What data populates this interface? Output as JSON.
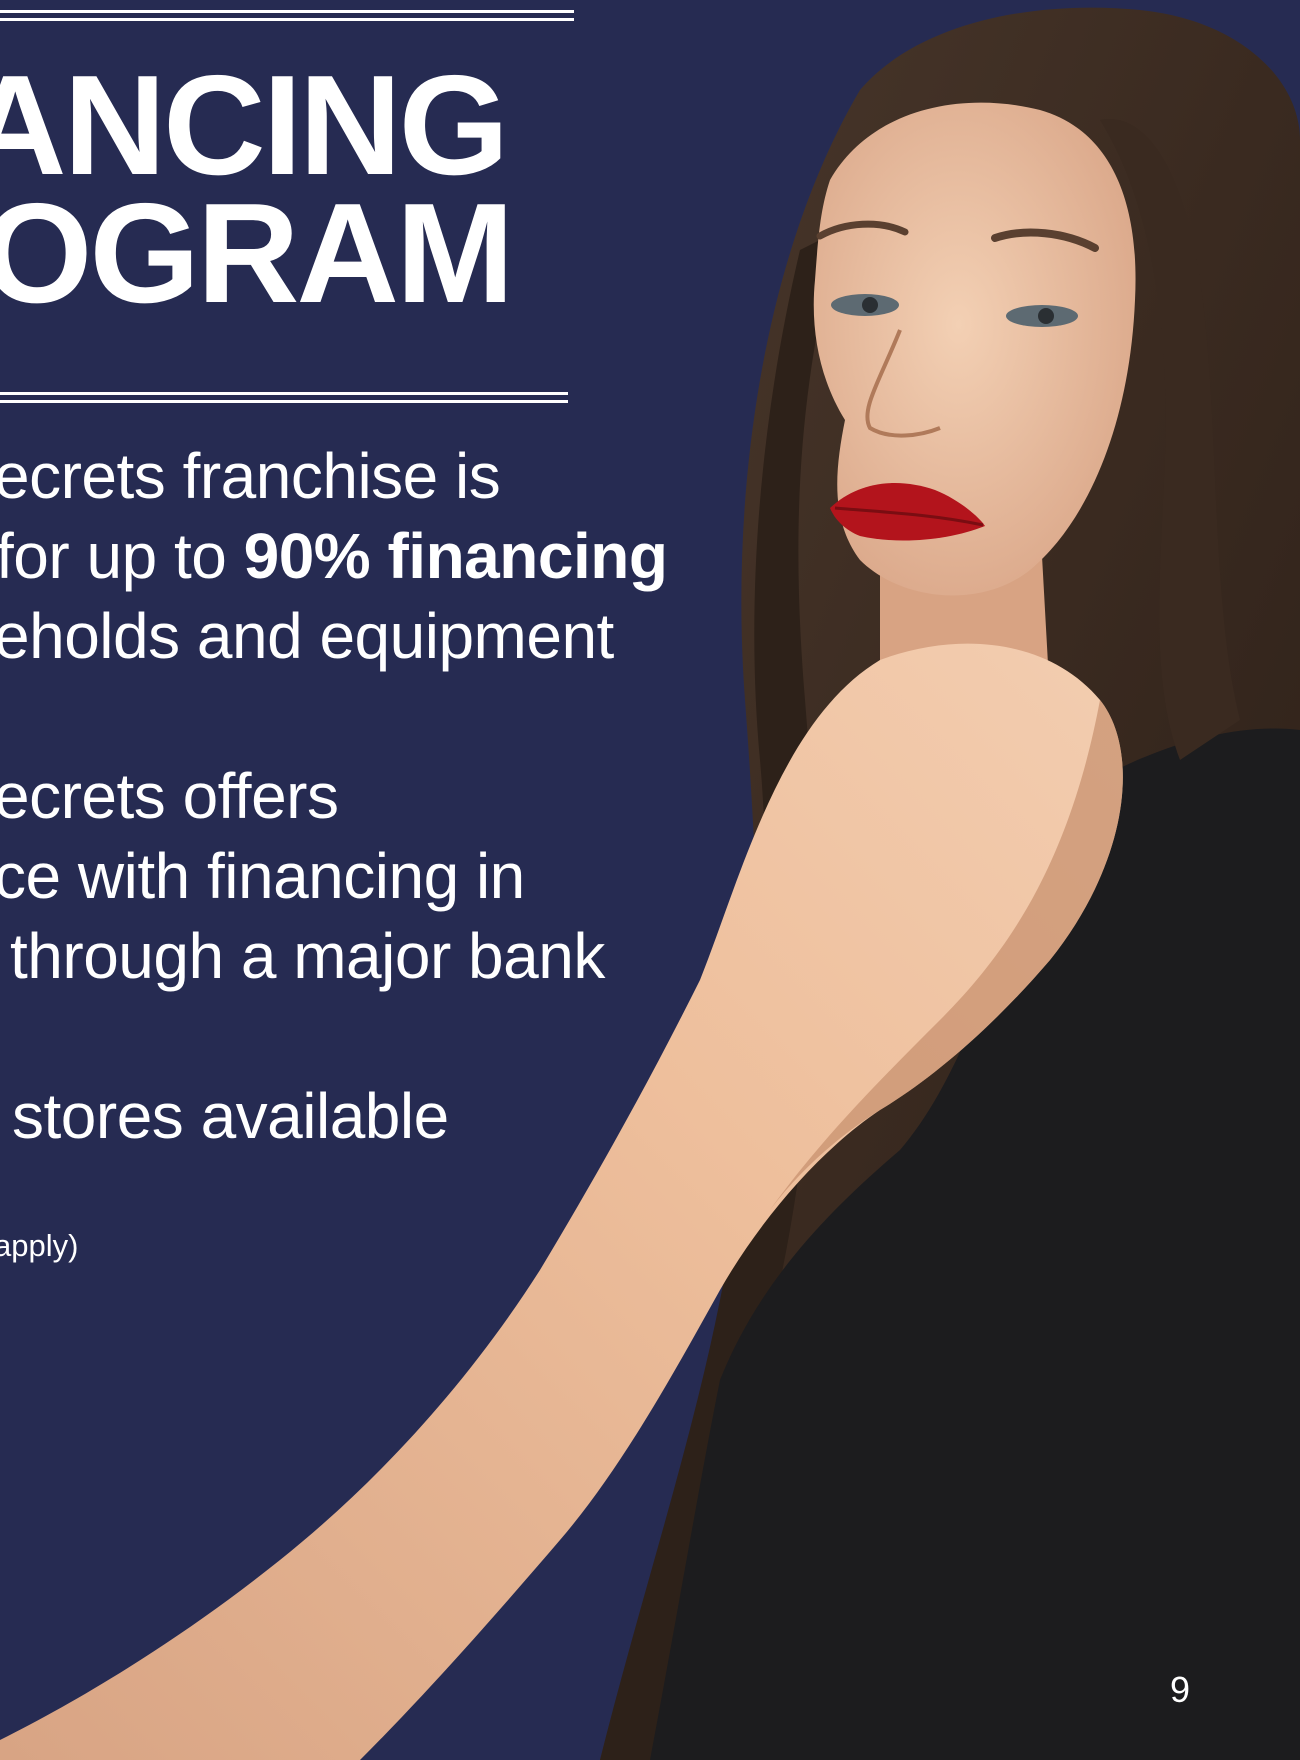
{
  "heading": {
    "line1": "ANCING",
    "line2": "OGRAM"
  },
  "paragraphs": {
    "p1": {
      "line1": "ecrets franchise is",
      "line2_a": "for up to ",
      "line2_b": "90% financing",
      "line3": "eholds and equipment"
    },
    "p2": {
      "line1": "ecrets offers",
      "line2": "ce with financing in",
      "line3": "through a major bank"
    },
    "p3": {
      "line1": "stores available"
    }
  },
  "note": "apply)",
  "page_number": "9",
  "colors": {
    "background": "#262b52",
    "text": "#ffffff",
    "hair": "#3a2a20",
    "skin": "#e0b090",
    "dress": "#1c1c1e",
    "lips": "#b3141c"
  },
  "image": {
    "subject": "woman with long brown hair in black sleeveless top, looking over shoulder"
  }
}
